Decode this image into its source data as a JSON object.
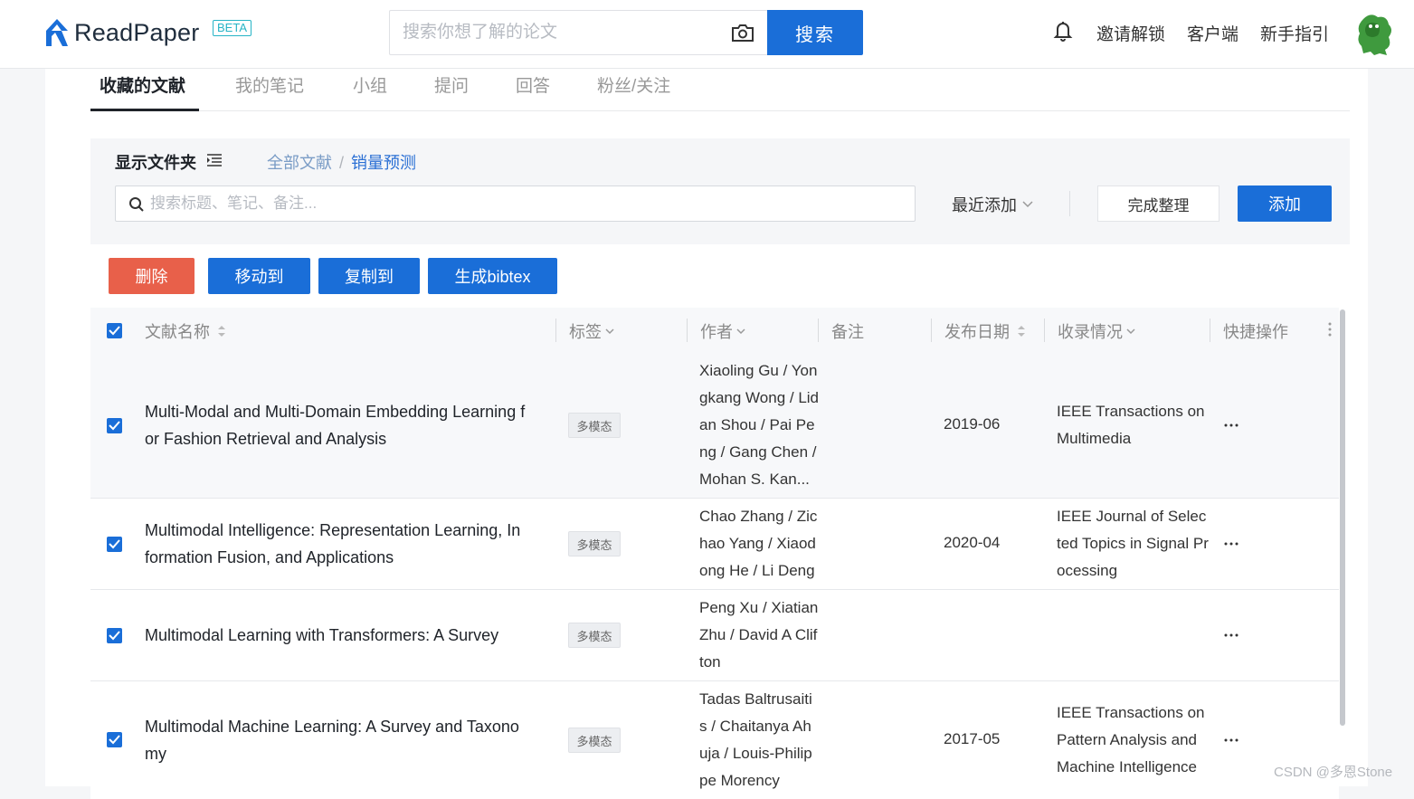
{
  "header": {
    "logo_text": "ReadPaper",
    "beta_label": "BETA",
    "search_placeholder": "搜索你想了解的论文",
    "search_button": "搜索",
    "nav": [
      "邀请解锁",
      "客户端",
      "新手指引"
    ]
  },
  "tabs": [
    {
      "label": "收藏的文献",
      "active": true
    },
    {
      "label": "我的笔记"
    },
    {
      "label": "小组"
    },
    {
      "label": "提问"
    },
    {
      "label": "回答"
    },
    {
      "label": "粉丝/关注"
    }
  ],
  "toolbar": {
    "folder_label": "显示文件夹",
    "breadcrumb": [
      "全部文献",
      "销量预测"
    ],
    "filter_placeholder": "搜索标题、笔记、备注...",
    "sort_label": "最近添加",
    "finish_button": "完成整理",
    "add_button": "添加"
  },
  "actions": {
    "delete": "删除",
    "move": "移动到",
    "copy": "复制到",
    "bibtex": "生成bibtex"
  },
  "table": {
    "columns": {
      "title": "文献名称",
      "tags": "标签",
      "authors": "作者",
      "notes": "备注",
      "date": "发布日期",
      "venue": "收录情况",
      "ops": "快捷操作"
    },
    "rows": [
      {
        "title": "Multi-Modal and Multi-Domain Embedding Learning for Fashion Retrieval and Analysis",
        "tag": "多模态",
        "authors": "Xiaoling Gu / Yongkang Wong / Lidan Shou / Pai Peng / Gang Chen / Mohan S. Kan...",
        "date": "2019-06",
        "venue": "IEEE Transactions on Multimedia"
      },
      {
        "title": "Multimodal Intelligence: Representation Learning, Information Fusion, and Applications",
        "tag": "多模态",
        "authors": "Chao Zhang / Zichao Yang / Xiaodong He / Li Deng",
        "date": "2020-04",
        "venue": "IEEE Journal of Selected Topics in Signal Processing"
      },
      {
        "title": "Multimodal Learning with Transformers: A Survey",
        "tag": "多模态",
        "authors": "Peng Xu / Xiatian Zhu / David A Clifton",
        "date": "",
        "venue": ""
      },
      {
        "title": "Multimodal Machine Learning: A Survey and Taxonomy",
        "tag": "多模态",
        "authors": "Tadas Baltrusaitis / Chaitanya Ahuja / Louis-Philippe Morency",
        "date": "2017-05",
        "venue": "IEEE Transactions on Pattern Analysis and Machine Intelligence"
      }
    ]
  },
  "watermark": "CSDN @多恩Stone",
  "colors": {
    "primary": "#1a6ed8",
    "danger": "#e8604a",
    "beta": "#27b4c6"
  }
}
